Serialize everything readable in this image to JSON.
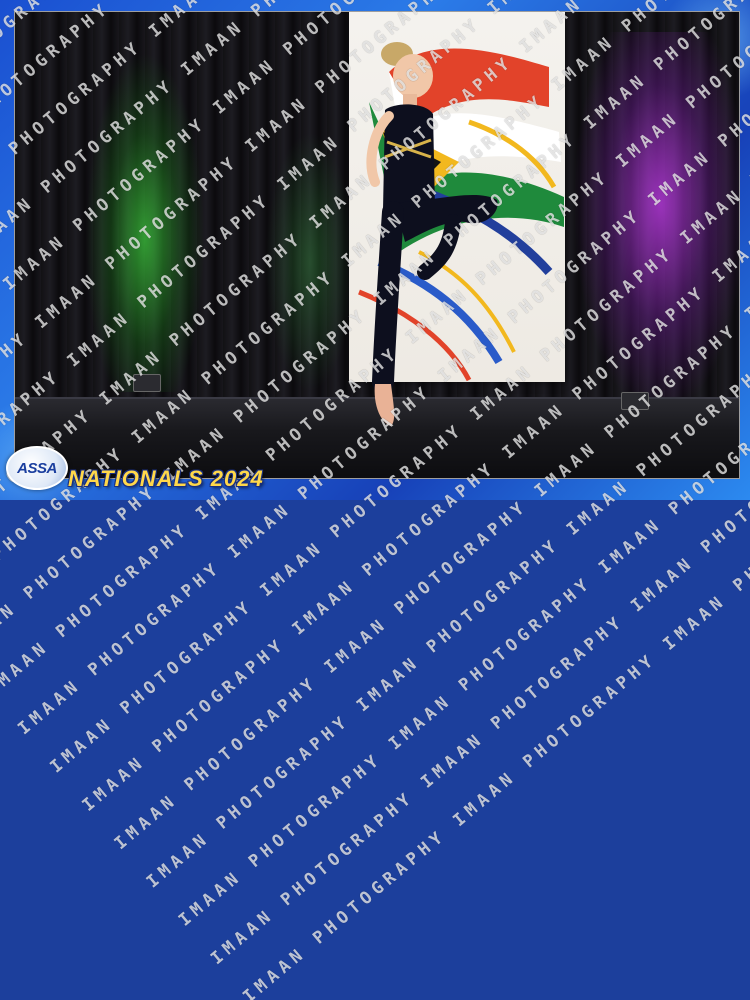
{
  "frame": {
    "accent": "#1c4fd0",
    "title_color": "#ffd84a"
  },
  "logo": {
    "text": "ASSA",
    "icon": "assa-logo-icon"
  },
  "event": {
    "title": "NATIONALS 2024"
  },
  "watermark": {
    "text": "IMAAN PHOTOGRAPHY"
  },
  "photo": {
    "subject": "dancer-icon",
    "backdrop": "flag-banner-icon",
    "lights": {
      "left": "#3cc83c",
      "right": "#be3ce6"
    }
  }
}
